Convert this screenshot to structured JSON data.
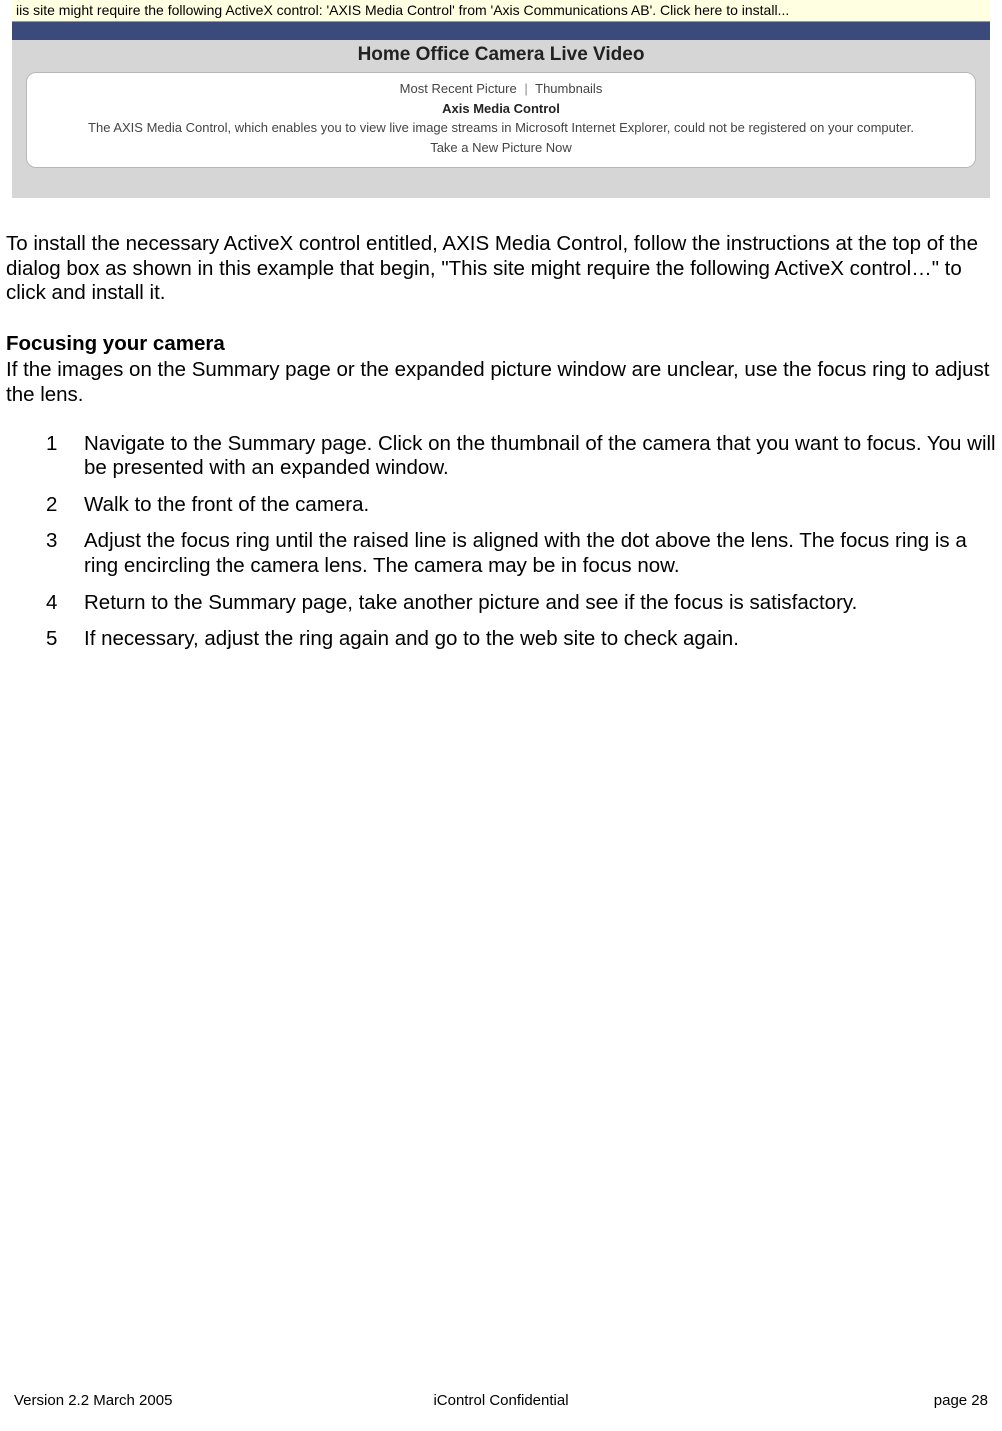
{
  "screenshot": {
    "infobar": "iis site might require the following ActiveX control: 'AXIS Media Control' from 'Axis Communications AB'. Click here to install...",
    "title": "Home Office Camera Live Video",
    "panel": {
      "link_recent": "Most Recent Picture",
      "link_thumbs": "Thumbnails",
      "bold_title": "Axis Media Control",
      "error_line": "The AXIS Media Control, which enables you to view live image streams in Microsoft Internet Explorer, could not be registered on your computer.",
      "take_picture": "Take a New Picture Now"
    }
  },
  "body": {
    "install_para": "To install the necessary ActiveX control entitled, AXIS Media Control, follow the instructions at the top of the dialog box as shown in this example that begin, \"This site might require the following ActiveX control…\" to click and install it.",
    "section_heading": "Focusing your camera",
    "section_intro": "If the images on the Summary page or the expanded picture window are unclear, use the focus ring to adjust the lens.",
    "steps": [
      "Navigate to the Summary page.  Click on the thumbnail of the camera that you want to focus.  You will be presented with an expanded window.",
      "Walk to the front of the camera.",
      "Adjust the focus ring until the raised line is aligned with the dot above the lens. The focus ring is a ring encircling the camera lens. The camera may be in focus now.",
      "Return to the Summary page, take another picture and see if the focus is satisfactory.",
      "If necessary, adjust the ring again and go to the web site to check again."
    ]
  },
  "footer": {
    "left": "Version 2.2 March 2005",
    "center": "iControl     Confidential",
    "right": "page 28"
  }
}
